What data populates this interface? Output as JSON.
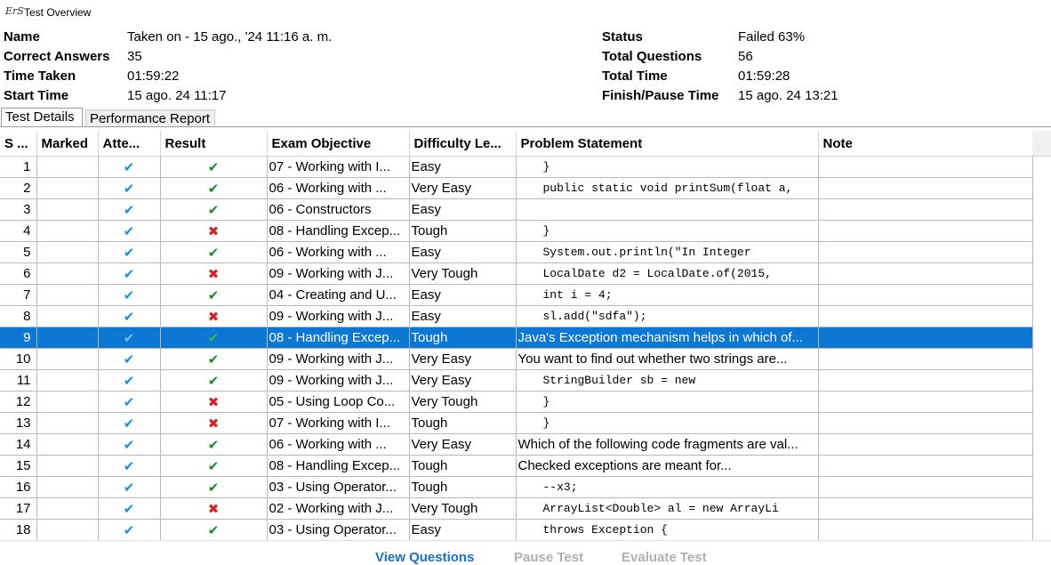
{
  "window": {
    "title": "Test Overview",
    "logo_text": "ErS"
  },
  "info": {
    "name_label": "Name",
    "name_value": "Taken on - 15 ago., '24 11:16 a. m.",
    "correct_label": "Correct Answers",
    "correct_value": "35",
    "time_taken_label": "Time Taken",
    "time_taken_value": "01:59:22",
    "start_label": "Start Time",
    "start_value": "15 ago. 24 11:17",
    "status_label": "Status",
    "status_value": "Failed 63%",
    "total_q_label": "Total Questions",
    "total_q_value": "56",
    "total_time_label": "Total Time",
    "total_time_value": "01:59:28",
    "finish_label": "Finish/Pause Time",
    "finish_value": "15 ago. 24 13:21"
  },
  "tabs": {
    "details": "Test Details",
    "performance": "Performance Report"
  },
  "table": {
    "columns": [
      "S ...",
      "Marked",
      "Atte...",
      "Result",
      "Exam Objective",
      "Difficulty Le...",
      "Problem Statement",
      "Note"
    ],
    "selected_row": 9,
    "rows": [
      {
        "n": "1",
        "attempted": "✔",
        "result": "correct",
        "objective": "07 - Working with I...",
        "difficulty": "Easy",
        "problem": "}",
        "code": true
      },
      {
        "n": "2",
        "attempted": "✔",
        "result": "correct",
        "objective": "06 - Working with ...",
        "difficulty": "Very Easy",
        "problem": "public static void printSum(float a,",
        "code": true
      },
      {
        "n": "3",
        "attempted": "✔",
        "result": "correct",
        "objective": "06 - Constructors",
        "difficulty": "Easy",
        "problem": "",
        "code": true
      },
      {
        "n": "4",
        "attempted": "✔",
        "result": "wrong",
        "objective": "08 - Handling Excep...",
        "difficulty": "Tough",
        "problem": "}",
        "code": true
      },
      {
        "n": "5",
        "attempted": "✔",
        "result": "correct",
        "objective": "06 - Working with ...",
        "difficulty": "Easy",
        "problem": "System.out.println(\"In Integer",
        "code": true
      },
      {
        "n": "6",
        "attempted": "✔",
        "result": "wrong",
        "objective": "09 - Working with J...",
        "difficulty": "Very Tough",
        "problem": "LocalDate d2 = LocalDate.of(2015,",
        "code": true
      },
      {
        "n": "7",
        "attempted": "✔",
        "result": "correct",
        "objective": "04 - Creating and U...",
        "difficulty": "Easy",
        "problem": "int i = 4;",
        "code": true
      },
      {
        "n": "8",
        "attempted": "✔",
        "result": "wrong",
        "objective": "09 - Working with J...",
        "difficulty": "Easy",
        "problem": "sl.add(\"sdfa\");",
        "code": true
      },
      {
        "n": "9",
        "attempted": "✔",
        "result": "correct",
        "objective": "08 - Handling Excep...",
        "difficulty": "Tough",
        "problem": "Java's Exception mechanism helps in which of...",
        "code": false
      },
      {
        "n": "10",
        "attempted": "✔",
        "result": "correct",
        "objective": "09 - Working with J...",
        "difficulty": "Very Easy",
        "problem": "You want to find out whether two strings are...",
        "code": false
      },
      {
        "n": "11",
        "attempted": "✔",
        "result": "correct",
        "objective": "09 - Working with J...",
        "difficulty": "Very Easy",
        "problem": "StringBuilder sb = new",
        "code": true
      },
      {
        "n": "12",
        "attempted": "✔",
        "result": "wrong",
        "objective": "05 - Using Loop Co...",
        "difficulty": "Very Tough",
        "problem": "}",
        "code": true
      },
      {
        "n": "13",
        "attempted": "✔",
        "result": "wrong",
        "objective": "07 - Working with I...",
        "difficulty": "Tough",
        "problem": "}",
        "code": true
      },
      {
        "n": "14",
        "attempted": "✔",
        "result": "correct",
        "objective": "06 - Working with ...",
        "difficulty": "Very Easy",
        "problem": "Which of the following code fragments are val...",
        "code": false
      },
      {
        "n": "15",
        "attempted": "✔",
        "result": "correct",
        "objective": "08 - Handling Excep...",
        "difficulty": "Tough",
        "problem": "Checked exceptions are meant for...",
        "code": false
      },
      {
        "n": "16",
        "attempted": "✔",
        "result": "correct",
        "objective": "03 - Using Operator...",
        "difficulty": "Tough",
        "problem": "--x3;",
        "code": true
      },
      {
        "n": "17",
        "attempted": "✔",
        "result": "wrong",
        "objective": "02 - Working with J...",
        "difficulty": "Very Tough",
        "problem": "ArrayList<Double> al = new ArrayLi",
        "code": true
      },
      {
        "n": "18",
        "attempted": "✔",
        "result": "correct",
        "objective": "03 - Using Operator...",
        "difficulty": "Easy",
        "problem": "throws Exception {",
        "code": true
      }
    ]
  },
  "bottom_buttons": {
    "view": "View Questions",
    "pause": "Pause Test",
    "evaluate": "Evaluate Test"
  },
  "colors": {
    "selection": "#0c78d4",
    "check_blue": "#1a8fdc",
    "check_green": "#1a8a2e",
    "cross_red": "#d92020"
  }
}
